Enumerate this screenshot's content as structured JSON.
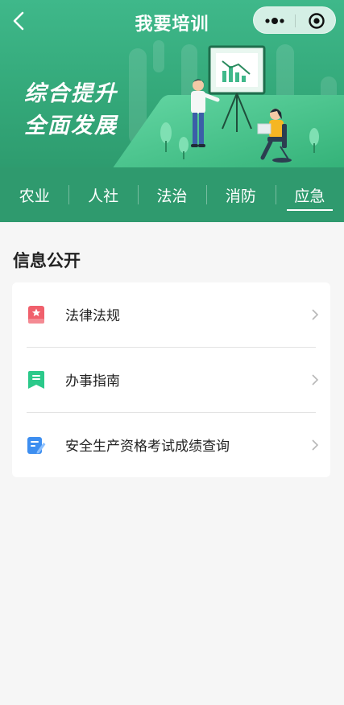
{
  "nav": {
    "title": "我要培训",
    "back_icon": "chevron-left-icon",
    "menu_icon": "more-dots-icon",
    "close_icon": "target-circle-icon"
  },
  "banner": {
    "line1": "综合提升",
    "line2": "全面发展"
  },
  "tabs": [
    {
      "label": "农业",
      "active": false
    },
    {
      "label": "人社",
      "active": false
    },
    {
      "label": "法治",
      "active": false
    },
    {
      "label": "消防",
      "active": false
    },
    {
      "label": "应急",
      "active": true
    }
  ],
  "section": {
    "title": "信息公开",
    "items": [
      {
        "label": "法律法规",
        "icon": "law-book-icon",
        "icon_color": "#f0606c"
      },
      {
        "label": "办事指南",
        "icon": "guide-book-icon",
        "icon_color": "#2bc98a"
      },
      {
        "label": "安全生产资格考试成绩查询",
        "icon": "exam-edit-icon",
        "icon_color": "#3d8ef0"
      }
    ]
  },
  "colors": {
    "brand_green": "#34a97a",
    "tab_bar": "#2f9a6e",
    "page_bg": "#f6f6f6"
  }
}
